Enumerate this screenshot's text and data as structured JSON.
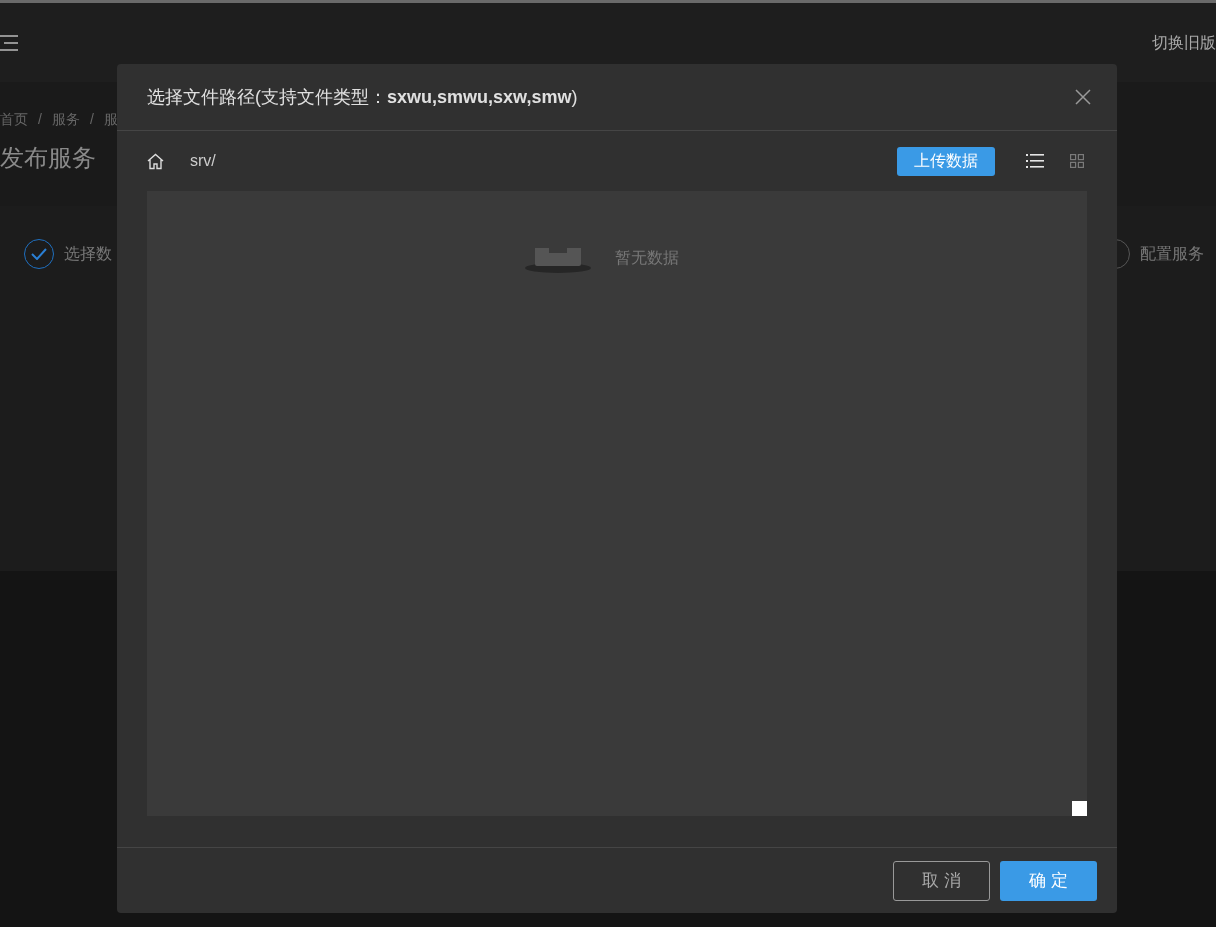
{
  "header": {
    "switch_link": "切换旧版"
  },
  "breadcrumb": {
    "items": [
      "首页",
      "服务",
      "服"
    ],
    "separator": "/"
  },
  "page_title": "发布服务",
  "steps": [
    {
      "label": "选择数",
      "done": true
    },
    {
      "label": "配置服务",
      "done": false
    }
  ],
  "dialog": {
    "title": "选择文件路径(支持文件类型：**sxwu,smwu,sxw,smw**)",
    "path": "srv/",
    "upload_button": "上传数据",
    "views": [
      {
        "kind": "list",
        "selected": true
      },
      {
        "kind": "grid",
        "selected": false
      }
    ],
    "empty_text": "暂无数据",
    "cancel_button": "取 消",
    "ok_button": "确 定"
  }
}
